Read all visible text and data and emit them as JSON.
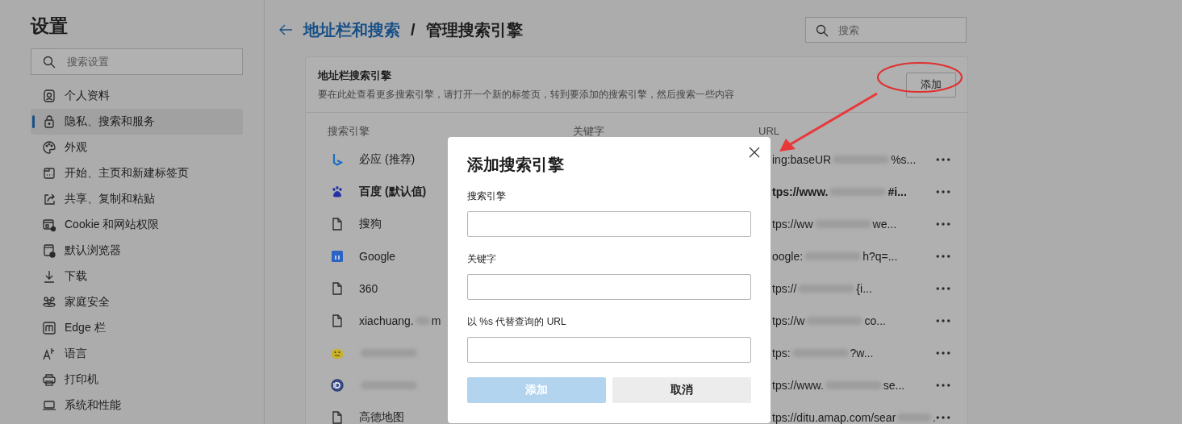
{
  "sidebar": {
    "title": "设置",
    "search": {
      "placeholder": "搜索设置"
    },
    "items": [
      {
        "label": "个人资料",
        "selected": false
      },
      {
        "label": "隐私、搜索和服务",
        "selected": true
      },
      {
        "label": "外观",
        "selected": false
      },
      {
        "label": "开始、主页和新建标签页",
        "selected": false
      },
      {
        "label": "共享、复制和粘贴",
        "selected": false
      },
      {
        "label": "Cookie 和网站权限",
        "selected": false
      },
      {
        "label": "默认浏览器",
        "selected": false
      },
      {
        "label": "下载",
        "selected": false
      },
      {
        "label": "家庭安全",
        "selected": false
      },
      {
        "label": "Edge 栏",
        "selected": false
      },
      {
        "label": "语言",
        "selected": false
      },
      {
        "label": "打印机",
        "selected": false
      },
      {
        "label": "系统和性能",
        "selected": false
      }
    ]
  },
  "header": {
    "link": "地址栏和搜索",
    "separator": "/",
    "title": "管理搜索引擎",
    "search": {
      "placeholder": "搜索"
    }
  },
  "card": {
    "title": "地址栏搜索引擎",
    "description": "要在此处查看更多搜索引擎，请打开一个新的标签页，转到要添加的搜索引擎，然后搜索一些内容",
    "add_button": "添加",
    "columns": [
      "搜索引擎",
      "关键字",
      "URL"
    ],
    "rows": [
      {
        "name": [
          "必应 (推荐)"
        ],
        "bold": false,
        "url": [
          "ing:baseUR",
          "%s..."
        ]
      },
      {
        "name": [
          "百度 (默认值)"
        ],
        "bold": true,
        "url": [
          "tps://www.",
          "#i..."
        ]
      },
      {
        "name": [
          "搜狗"
        ],
        "bold": false,
        "url": [
          "tps://ww",
          "we..."
        ]
      },
      {
        "name": [
          "Google"
        ],
        "bold": false,
        "url": [
          "oogle:",
          "h?q=..."
        ]
      },
      {
        "name": [
          "360"
        ],
        "bold": false,
        "url": [
          "tps://",
          "{i..."
        ]
      },
      {
        "name": [
          "xiachuang.",
          "m"
        ],
        "bold": false,
        "url": [
          "tps://w",
          "co..."
        ]
      },
      {
        "bold": false,
        "url": [
          "tps:",
          "?w..."
        ]
      },
      {
        "bold": false,
        "url": [
          "tps://www.",
          "se..."
        ]
      },
      {
        "name": [
          "高德地图"
        ],
        "bold": false,
        "url": [
          "tps://ditu.amap.com/sear",
          "."
        ]
      }
    ]
  },
  "dialog": {
    "title": "添加搜索引擎",
    "fields": [
      {
        "label": "搜索引擎"
      },
      {
        "label": "关键字"
      },
      {
        "label": "以 %s 代替查询的 URL"
      }
    ],
    "buttons": [
      {
        "label": "添加",
        "kind": "primary",
        "disabled": true
      },
      {
        "label": "取消",
        "kind": "secondary",
        "disabled": false
      }
    ]
  },
  "annotation": {
    "kind": "circle-and-arrow"
  }
}
